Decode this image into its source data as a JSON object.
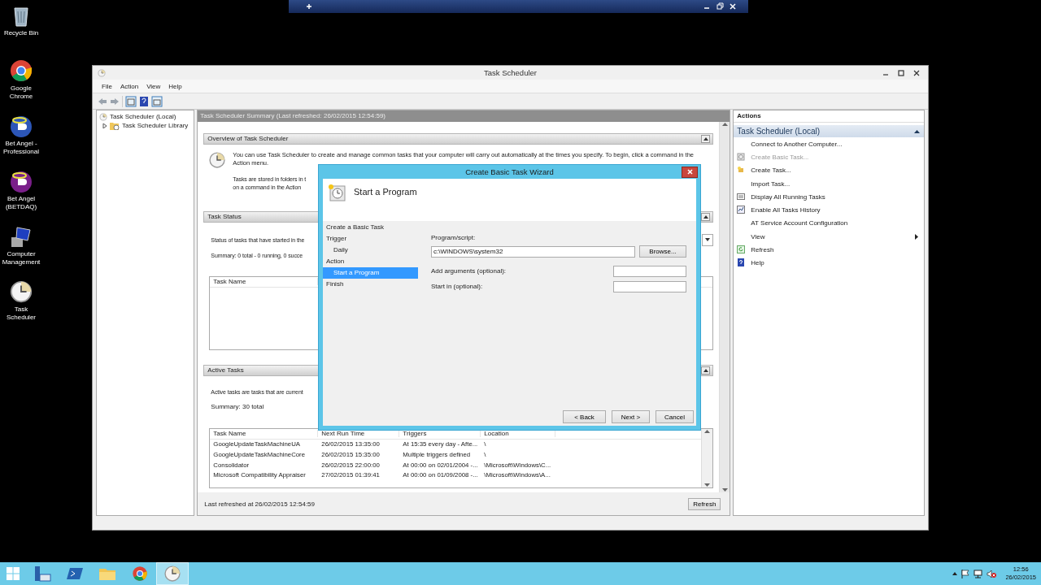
{
  "desktop_icons": [
    {
      "label": "Recycle Bin",
      "kind": "recycle-bin"
    },
    {
      "label": "Google Chrome",
      "kind": "browser"
    },
    {
      "label": "Bet Angel - Professional",
      "kind": "angel-blue"
    },
    {
      "label": "Bet Angel (BETDAQ)",
      "kind": "angel-purple"
    },
    {
      "label": "Computer Management",
      "kind": "management"
    },
    {
      "label": "Task Scheduler",
      "kind": "scheduler"
    }
  ],
  "main_window": {
    "title": "Task Scheduler",
    "menu": [
      "File",
      "Action",
      "View",
      "Help"
    ],
    "tree": [
      {
        "label": "Task Scheduler (Local)",
        "children": [
          {
            "label": "Task Scheduler Library",
            "expanded": false
          }
        ]
      }
    ],
    "summary": {
      "header": "Task Scheduler Summary (Last refreshed: 26/02/2015 12:54:59)",
      "sections": [
        {
          "kind": "overview",
          "title": "Overview of Task Scheduler",
          "expanded": true,
          "paragraphs": [
            [
              "You can use Task Scheduler to create and manage common tasks that your computer will carry out automatically at the times you specify. To begin, click a command in the Action menu."
            ],
            [
              "Tasks are stored in folders in t",
              "on a command in the Action"
            ]
          ]
        },
        {
          "kind": "status",
          "title": "Task Status",
          "expanded": true,
          "text": "Status of tasks that have started in the",
          "summary": "Summary: 0 total - 0 running, 0 succe",
          "table": {
            "columns": [
              "Task Name"
            ]
          }
        },
        {
          "kind": "active",
          "title": "Active Tasks",
          "expanded": true,
          "text": "Active tasks are tasks that are current",
          "summary": "Summary: 30 total",
          "table": {
            "columns": [
              "Task Name",
              "Next Run Time",
              "Triggers",
              "Location"
            ],
            "rows": [
              [
                "GoogleUpdateTaskMachineUA",
                "26/02/2015 13:35:00",
                "At 15:35 every day - Afte...",
                "\\"
              ],
              [
                "GoogleUpdateTaskMachineCore",
                "26/02/2015 15:35:00",
                "Multiple triggers defined",
                "\\"
              ],
              [
                "Consolidator",
                "26/02/2015 22:00:00",
                "At 00:00 on 02/01/2004 -...",
                "\\Microsoft\\Windows\\C..."
              ],
              [
                "Microsoft Compatibility Appraiser",
                "27/02/2015 01:39:41",
                "At 00:00 on 01/09/2008 -...",
                "\\Microsoft\\Windows\\A..."
              ]
            ]
          }
        }
      ],
      "last_refreshed": "Last refreshed at 26/02/2015 12:54:59",
      "refresh_button": "Refresh"
    },
    "actions": {
      "header": "Actions",
      "group": "Task Scheduler (Local)",
      "items": [
        {
          "label": "Connect to Another Computer...",
          "kind": "none",
          "disabled": false,
          "submenu": false
        },
        {
          "label": "Create Basic Task...",
          "kind": "wizard",
          "disabled": true,
          "submenu": false
        },
        {
          "label": "Create Task...",
          "kind": "task",
          "disabled": false,
          "submenu": false
        },
        {
          "label": "Import Task...",
          "kind": "none",
          "disabled": false,
          "submenu": false
        },
        {
          "label": "Display All Running Tasks",
          "kind": "list",
          "disabled": false,
          "submenu": false
        },
        {
          "label": "Enable All Tasks History",
          "kind": "history",
          "disabled": false,
          "submenu": false
        },
        {
          "label": "AT Service Account Configuration",
          "kind": "none",
          "disabled": false,
          "submenu": false
        },
        {
          "label": "View",
          "kind": "none",
          "disabled": false,
          "submenu": true
        },
        {
          "label": "Refresh",
          "kind": "refresh",
          "disabled": false,
          "submenu": false
        },
        {
          "label": "Help",
          "kind": "help",
          "disabled": false,
          "submenu": false
        }
      ]
    }
  },
  "wizard": {
    "title": "Create Basic Task Wizard",
    "heading": "Start a Program",
    "steps": [
      {
        "label": "Create a Basic Task",
        "selected": false
      },
      {
        "label": "Trigger",
        "selected": false,
        "children": [
          {
            "label": "Daily",
            "selected": false
          }
        ]
      },
      {
        "label": "Action",
        "selected": false,
        "children": [
          {
            "label": "Start a Program",
            "selected": true
          }
        ]
      },
      {
        "label": "Finish",
        "selected": false
      }
    ],
    "fields": [
      {
        "kind": "wide",
        "label": "Program/script:",
        "value": "c:\\WINDOWS\\system32",
        "button": "Browse..."
      },
      {
        "kind": "inline",
        "label": "Add arguments (optional):"
      },
      {
        "kind": "inline",
        "label": "Start in (optional):"
      }
    ],
    "buttons": [
      "< Back",
      "Next >",
      "Cancel"
    ]
  },
  "taskbar": {
    "apps": [
      {
        "kind": "server-manager",
        "selected": false
      },
      {
        "kind": "powershell",
        "selected": false
      },
      {
        "kind": "explorer",
        "selected": false
      },
      {
        "kind": "browser",
        "selected": false
      },
      {
        "kind": "scheduler",
        "selected": true
      }
    ],
    "time": "12:56",
    "date": "26/02/2015"
  }
}
